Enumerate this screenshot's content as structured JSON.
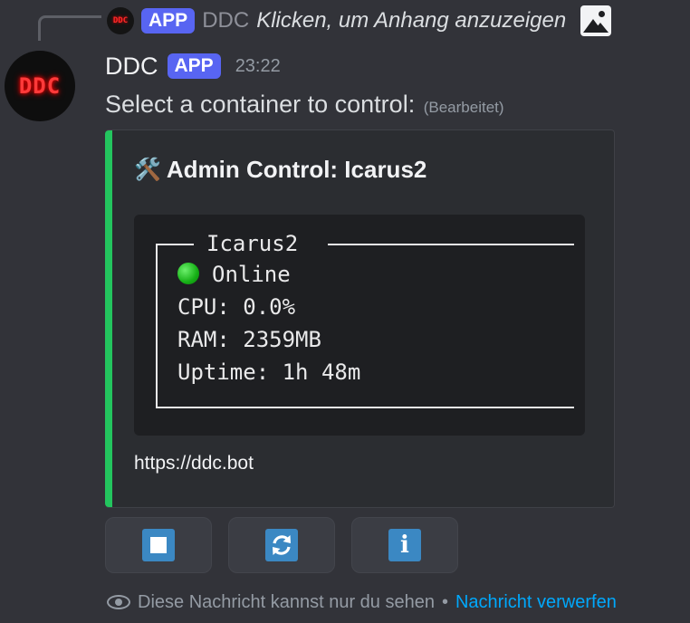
{
  "reply": {
    "avatar_text": "DDC",
    "badge": "APP",
    "author": "DDC",
    "text": "Klicken, um Anhang anzuzeigen",
    "attachment_icon": "image-icon"
  },
  "message": {
    "avatar_text": "DDC",
    "author": "DDC",
    "badge": "APP",
    "timestamp": "23:22",
    "content": "Select a container to control:",
    "edited": "(Bearbeitet)"
  },
  "embed": {
    "accent_color": "#23c55e",
    "title_icon": "🛠️",
    "title": "Admin Control: Icarus2",
    "code": {
      "box_title": "Icarus2",
      "status": "Online",
      "status_color": "#16b016",
      "cpu": "CPU: 0.0%",
      "ram": "RAM: 2359MB",
      "uptime": "Uptime: 1h 48m"
    },
    "footer_link": "https://ddc.bot"
  },
  "buttons": [
    {
      "name": "stop-button",
      "icon": "stop-icon"
    },
    {
      "name": "restart-button",
      "icon": "refresh-icon"
    },
    {
      "name": "info-button",
      "icon": "info-icon"
    }
  ],
  "ephemeral": {
    "notice": "Diese Nachricht kannst nur du sehen",
    "separator": "•",
    "dismiss": "Nachricht verwerfen"
  }
}
